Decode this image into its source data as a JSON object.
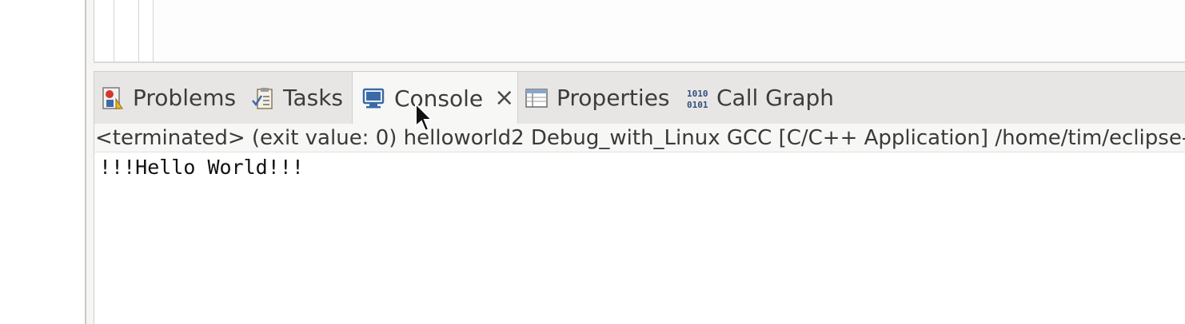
{
  "tabs": [
    {
      "label": "Problems",
      "icon": "problems-icon"
    },
    {
      "label": "Tasks",
      "icon": "tasks-icon"
    },
    {
      "label": "Console",
      "icon": "console-icon",
      "active": true,
      "closable": true
    },
    {
      "label": "Properties",
      "icon": "properties-icon"
    },
    {
      "label": "Call Graph",
      "icon": "call-graph-icon"
    }
  ],
  "console": {
    "header": "<terminated> (exit value: 0) helloworld2 Debug_with_Linux GCC [C/C++ Application] /home/tim/eclipse-",
    "output_lines": [
      "!!!Hello World!!!"
    ]
  },
  "colors": {
    "tabbar_bg": "#e8e6e4",
    "active_tab_bg": "#f7f7f6",
    "icon_blue": "#3b6aa8"
  }
}
